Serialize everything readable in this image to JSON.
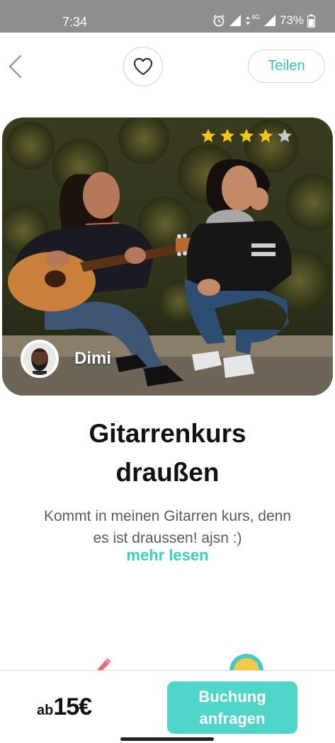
{
  "status_bar": {
    "time": "7:34",
    "network": "4G",
    "battery": "73%",
    "icons": [
      "alarm-icon",
      "signal-icon",
      "data-arrows-icon",
      "signal-icon",
      "battery-icon"
    ]
  },
  "top_bar": {
    "back_icon": "chevron-left-icon",
    "favorite_icon": "heart-outline-icon",
    "share_label": "Teilen"
  },
  "hero": {
    "image": "two women sitting outdoors, one playing guitar",
    "rating": {
      "value": 4,
      "max": 5
    },
    "host_name": "Dimi"
  },
  "course": {
    "title_line1": "Gitarrenkurs",
    "title_line2": "draußen",
    "description_line1": "Kommt in meinen Gitarren kurs, denn",
    "description_line2": "es ist draussen! ajsn :)",
    "read_more": "mehr lesen"
  },
  "bottom_bar": {
    "price_prefix": "ab",
    "price_value": "15€",
    "book_label_line1": "Buchung",
    "book_label_line2": "anfragen"
  },
  "colors": {
    "accent": "#4fd6c8",
    "accent_text": "#3bcfc1",
    "star_filled": "#f5c518",
    "star_empty": "#c8c8c8",
    "status_bar": "#8e8e8e"
  }
}
